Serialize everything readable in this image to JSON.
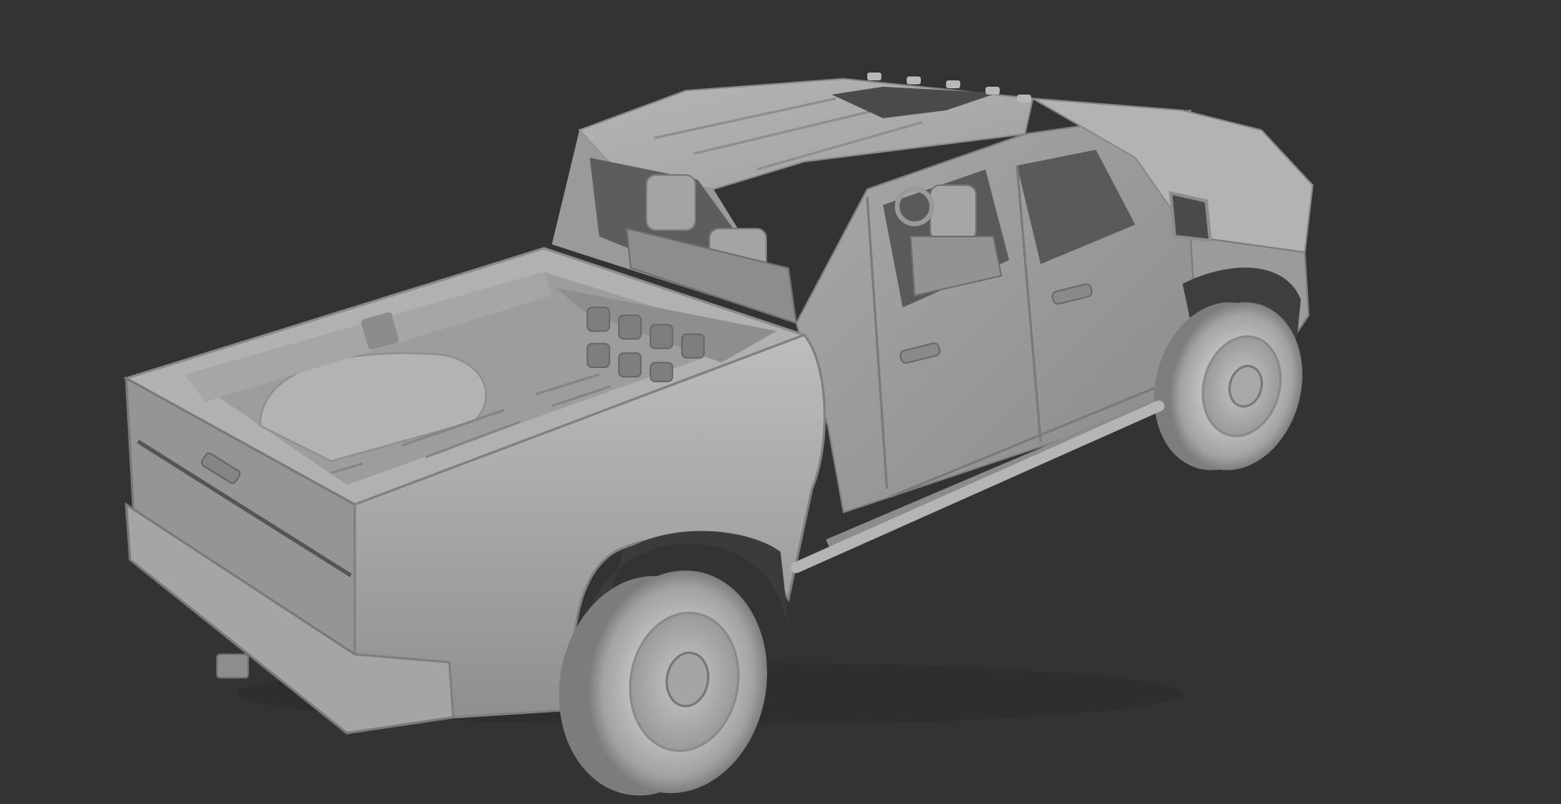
{
  "scene": {
    "background_color": "#333333",
    "model_color": "#a8a8a8",
    "model_highlight": "#c4c4c4",
    "model_shadow": "#6a6a6a",
    "model_dark": "#3d3d3d",
    "subject": "dually-pickup-truck-clay-render"
  }
}
